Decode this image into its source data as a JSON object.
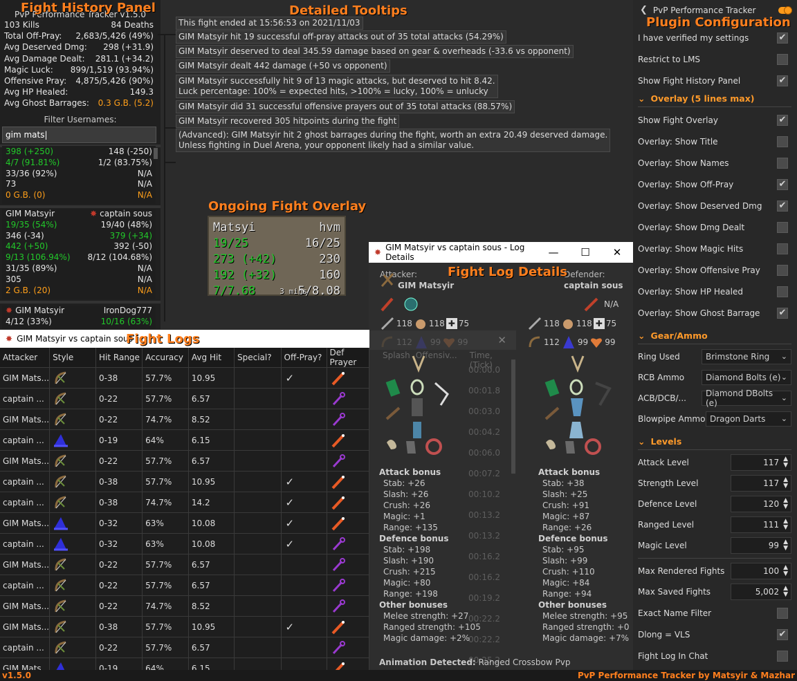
{
  "annotations": {
    "fight_history": "Fight History Panel",
    "tooltips": "Detailed Tooltips",
    "plugin_config": "Plugin Configuration",
    "overlay": "Ongoing Fight Overlay",
    "logs": "Fight Logs",
    "log_details": "Fight Log Details"
  },
  "panel": {
    "title": "PvP Performance Tracker v1.5.0",
    "stats": [
      {
        "label": "103 Kills",
        "value": "84 Deaths"
      },
      {
        "label": "Total Off-Pray:",
        "value": "2,683/5,426 (49%)"
      },
      {
        "label": "Avg Deserved Dmg:",
        "value": "298 (+31.9)"
      },
      {
        "label": "Avg Damage Dealt:",
        "value": "281.1 (+34.2)"
      },
      {
        "label": "Magic Luck:",
        "value": "899/1,519 (93.94%)"
      },
      {
        "label": "Offensive Pray:",
        "value": "4,875/5,426 (90%)"
      },
      {
        "label": "Avg HP Healed:",
        "value": "149.3"
      },
      {
        "label": "Avg Ghost Barrages:",
        "value": "0.3 G.B. (5.2)"
      }
    ],
    "filter_label": "Filter Usernames:",
    "filter_value": "gim mats",
    "fight1": [
      {
        "l": "398 (+250)",
        "r": "148 (-250)",
        "lc": "green",
        "rc": "wh"
      },
      {
        "l": "4/7 (91.81%)",
        "r": "1/2 (83.75%)",
        "lc": "green",
        "rc": "wh"
      },
      {
        "l": "33/36 (92%)",
        "r": "N/A",
        "lc": "wh",
        "rc": "wh"
      },
      {
        "l": "73",
        "r": "N/A",
        "lc": "wh",
        "rc": "wh"
      },
      {
        "l": "0 G.B. (0)",
        "r": "N/A",
        "lc": "gold",
        "rc": "gold"
      }
    ],
    "fight2": {
      "left_name": "GIM Matsyir",
      "right_name": "captain sous",
      "rows": [
        {
          "l": "19/35 (54%)",
          "r": "19/40 (48%)",
          "lc": "green",
          "rc": "wh"
        },
        {
          "l": "346 (-34)",
          "r": "379 (+34)",
          "lc": "wh",
          "rc": "green"
        },
        {
          "l": "442 (+50)",
          "r": "392 (-50)",
          "lc": "green",
          "rc": "wh"
        },
        {
          "l": "9/13 (106.94%)",
          "r": "8/12 (104.68%)",
          "lc": "green",
          "rc": "wh"
        },
        {
          "l": "31/35 (89%)",
          "r": "N/A",
          "lc": "wh",
          "rc": "wh"
        },
        {
          "l": "305",
          "r": "N/A",
          "lc": "wh",
          "rc": "wh"
        },
        {
          "l": "2 G.B. (20)",
          "r": "N/A",
          "lc": "gold",
          "rc": "gold"
        }
      ]
    },
    "fight3": {
      "left_name": "GIM Matsyir",
      "right_name": "IronDog777",
      "rows": [
        {
          "l": "4/12 (33%)",
          "r": "10/16 (63%)",
          "lc": "wh",
          "rc": "green"
        }
      ]
    }
  },
  "tooltips": [
    "This fight ended at 15:56:53 on 2021/11/03",
    "GIM Matsyir hit 19 successful off-pray attacks out of 35 total attacks (54.29%)",
    "GIM Matsyir deserved to deal 345.59 damage based on gear & overheads (-33.6 vs opponent)",
    "GIM Matsyir dealt 442 damage (+50 vs opponent)",
    "GIM Matsyir successfully hit 9 of 13 magic attacks, but deserved to hit 8.42.\nLuck percentage: 100% = expected hits, >100% = lucky, 100% = unlucky",
    "GIM Matsyir did 31 successful offensive prayers out of 35 total attacks (88.57%)",
    "GIM Matsyir recovered 305 hitpoints during the fight",
    "(Advanced): GIM Matsyir hit 2 ghost barrages during the fight, worth an extra 20.49 deserved damage.\nUnless fighting in Duel Arena, your opponent likely had a similar value."
  ],
  "overlay": {
    "rows": [
      {
        "l": "Matsyi",
        "r": "hvm",
        "lc": "wh"
      },
      {
        "l": "19/25",
        "r": "16/25",
        "lc": "green"
      },
      {
        "l": "273 (+42)",
        "r": "230",
        "lc": "green"
      },
      {
        "l": "192 (+32)",
        "r": "160",
        "lc": "green"
      },
      {
        "l": "7/7.68",
        "r": "5/8.08",
        "lc": "green"
      }
    ],
    "timer": "3 mins"
  },
  "logs": {
    "title": "GIM Matsyir vs captain sous",
    "columns": [
      "Attacker",
      "Style",
      "Hit Range",
      "Accuracy",
      "Avg Hit",
      "Special?",
      "Off-Pray?",
      "Def Prayer"
    ],
    "rows": [
      {
        "a": "GIM Mats...",
        "s": "bow",
        "h": "0-38",
        "ac": "57.7%",
        "av": "10.95",
        "op": "✓",
        "p": "red"
      },
      {
        "a": "captain ...",
        "s": "bow",
        "h": "0-22",
        "ac": "57.7%",
        "av": "6.57",
        "op": "",
        "p": "purple"
      },
      {
        "a": "GIM Mats...",
        "s": "bow",
        "h": "0-22",
        "ac": "74.7%",
        "av": "8.52",
        "op": "",
        "p": "purple"
      },
      {
        "a": "captain ...",
        "s": "hat",
        "h": "0-19",
        "ac": "64%",
        "av": "6.15",
        "op": "",
        "p": "red"
      },
      {
        "a": "GIM Mats...",
        "s": "bow",
        "h": "0-22",
        "ac": "57.7%",
        "av": "6.57",
        "op": "",
        "p": "purple"
      },
      {
        "a": "captain ...",
        "s": "bow",
        "h": "0-38",
        "ac": "57.7%",
        "av": "10.95",
        "op": "✓",
        "p": "red"
      },
      {
        "a": "captain ...",
        "s": "bow",
        "h": "0-38",
        "ac": "74.7%",
        "av": "14.2",
        "op": "✓",
        "p": "red"
      },
      {
        "a": "GIM Mats...",
        "s": "hat",
        "h": "0-32",
        "ac": "63%",
        "av": "10.08",
        "op": "✓",
        "p": "red"
      },
      {
        "a": "captain ...",
        "s": "hat",
        "h": "0-32",
        "ac": "63%",
        "av": "10.08",
        "op": "✓",
        "p": "purple"
      },
      {
        "a": "GIM Mats...",
        "s": "bow",
        "h": "0-22",
        "ac": "57.7%",
        "av": "6.57",
        "op": "",
        "p": "purple"
      },
      {
        "a": "captain ...",
        "s": "bow",
        "h": "0-22",
        "ac": "57.7%",
        "av": "6.57",
        "op": "",
        "p": "purple"
      },
      {
        "a": "GIM Mats...",
        "s": "bow",
        "h": "0-22",
        "ac": "74.7%",
        "av": "8.52",
        "op": "",
        "p": "purple"
      },
      {
        "a": "GIM Mats...",
        "s": "bow",
        "h": "0-38",
        "ac": "57.7%",
        "av": "10.95",
        "op": "✓",
        "p": "red"
      },
      {
        "a": "captain ...",
        "s": "bow",
        "h": "0-22",
        "ac": "57.7%",
        "av": "6.57",
        "op": "",
        "p": "purple"
      },
      {
        "a": "GIM Mats...",
        "s": "hat",
        "h": "0-19",
        "ac": "64%",
        "av": "6.15",
        "op": "",
        "p": "red"
      }
    ]
  },
  "details": {
    "title": "GIM Matsyir vs captain sous - Log Details",
    "attacker_label": "Attacker:",
    "attacker_name": "GIM Matsyir",
    "defender_label": "Defender:",
    "defender_name": "captain sous",
    "na": "N/A",
    "att_levels": [
      "118",
      "118",
      "75",
      "112",
      "99",
      "99"
    ],
    "def_levels": [
      "118",
      "118",
      "75",
      "112",
      "99",
      "99"
    ],
    "behind_cols": [
      "Splash",
      "Offensiv...",
      "Time, (Tick)"
    ],
    "behind_times": [
      "00:00.0",
      "00:01.8",
      "00:03.0",
      "00:04.2",
      "00:06.0",
      "00:07.2",
      "00:10.2",
      "00:13.2",
      "00:13.2",
      "00:16.2",
      "00:16.2",
      "00:19.2",
      "00:22.2",
      "00:22.2",
      "00:25.2"
    ],
    "att_bonus": {
      "attack_h": "Attack bonus",
      "attack": [
        "Stab: +26",
        "Slash: +26",
        "Crush: +26",
        "Magic: +1",
        "Range: +135"
      ],
      "defence_h": "Defence bonus",
      "defence": [
        "Stab: +198",
        "Slash: +190",
        "Crush: +215",
        "Magic: +80",
        "Range: +198"
      ],
      "other_h": "Other bonuses",
      "other": [
        "Melee strength: +27",
        "Ranged strength: +105",
        "Magic damage: +2%"
      ]
    },
    "def_bonus": {
      "attack_h": "Attack bonus",
      "attack": [
        "Stab: +38",
        "Slash: +25",
        "Crush: +91",
        "Magic: +87",
        "Range: +26"
      ],
      "defence_h": "Defence bonus",
      "defence": [
        "Stab: +95",
        "Slash: +99",
        "Crush: +110",
        "Magic: +84",
        "Range: +94"
      ],
      "other_h": "Other bonuses",
      "other": [
        "Melee strength: +95",
        "Ranged strength: +0",
        "Magic damage: +7%"
      ]
    },
    "animation_label": "Animation Detected:",
    "animation_value": "Ranged Crossbow Pvp"
  },
  "config": {
    "title": "PvP Performance Tracker",
    "top": [
      {
        "label": "I have verified my settings",
        "checked": true
      },
      {
        "label": "Restrict to LMS",
        "checked": false
      },
      {
        "label": "Show Fight History Panel",
        "checked": true
      }
    ],
    "overlay_section": "Overlay (5 lines max)",
    "overlay": [
      {
        "label": "Show Fight Overlay",
        "checked": true
      },
      {
        "label": "Overlay: Show Title",
        "checked": false
      },
      {
        "label": "Overlay: Show Names",
        "checked": false
      },
      {
        "label": "Overlay: Show Off-Pray",
        "checked": true
      },
      {
        "label": "Overlay: Show Deserved Dmg",
        "checked": true
      },
      {
        "label": "Overlay: Show Dmg Dealt",
        "checked": false
      },
      {
        "label": "Overlay: Show Magic Hits",
        "checked": false
      },
      {
        "label": "Overlay: Show Offensive Pray",
        "checked": false
      },
      {
        "label": "Overlay: Show HP Healed",
        "checked": false
      },
      {
        "label": "Overlay: Show Ghost Barrage",
        "checked": true
      }
    ],
    "gear_section": "Gear/Ammo",
    "gear": [
      {
        "label": "Ring Used",
        "value": "Brimstone Ring"
      },
      {
        "label": "RCB Ammo",
        "value": "Diamond Bolts (e)"
      },
      {
        "label": "ACB/DCB/...",
        "value": "Diamond DBolts (e)"
      },
      {
        "label": "Blowpipe Ammo",
        "value": "Dragon Darts"
      }
    ],
    "levels_section": "Levels",
    "levels": [
      {
        "label": "Attack Level",
        "value": "117"
      },
      {
        "label": "Strength Level",
        "value": "117"
      },
      {
        "label": "Defence Level",
        "value": "120"
      },
      {
        "label": "Ranged Level",
        "value": "111"
      },
      {
        "label": "Magic Level",
        "value": "99"
      }
    ],
    "misc_spins": [
      {
        "label": "Max Rendered Fights",
        "value": "100"
      },
      {
        "label": "Max Saved Fights",
        "value": "5,002"
      }
    ],
    "misc_checks": [
      {
        "label": "Exact Name Filter",
        "checked": false
      },
      {
        "label": "Dlong = VLS",
        "checked": true
      },
      {
        "label": "Fight Log In Chat",
        "checked": false
      }
    ]
  },
  "footer": {
    "left": "v1.5.0",
    "right": "PvP Performance Tracker by Matsyir & Mazhar"
  }
}
